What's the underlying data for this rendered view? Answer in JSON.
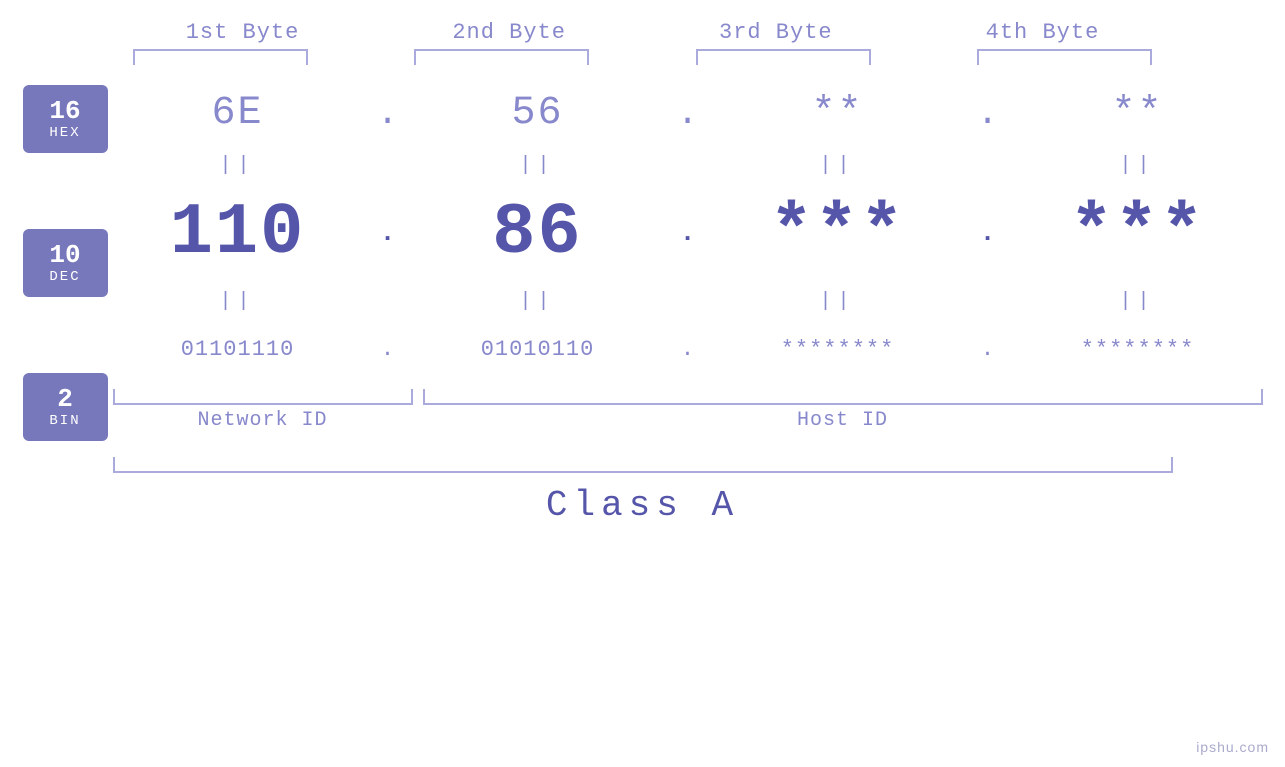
{
  "page": {
    "background": "#ffffff",
    "watermark": "ipshu.com"
  },
  "headers": {
    "byte1": "1st Byte",
    "byte2": "2nd Byte",
    "byte3": "3rd Byte",
    "byte4": "4th Byte"
  },
  "badges": {
    "hex": {
      "number": "16",
      "label": "HEX"
    },
    "dec": {
      "number": "10",
      "label": "DEC"
    },
    "bin": {
      "number": "2",
      "label": "BIN"
    }
  },
  "hex_row": {
    "b1": "6E",
    "b2": "56",
    "b3": "**",
    "b4": "**",
    "dot": "."
  },
  "eq_row": {
    "symbol": "||"
  },
  "dec_row": {
    "b1": "110",
    "b2": "86",
    "b3": "***",
    "b4": "***",
    "dot": "."
  },
  "bin_row": {
    "b1": "01101110",
    "b2": "01010110",
    "b3": "********",
    "b4": "********",
    "dot": "."
  },
  "labels": {
    "network_id": "Network ID",
    "host_id": "Host ID",
    "class": "Class A"
  }
}
